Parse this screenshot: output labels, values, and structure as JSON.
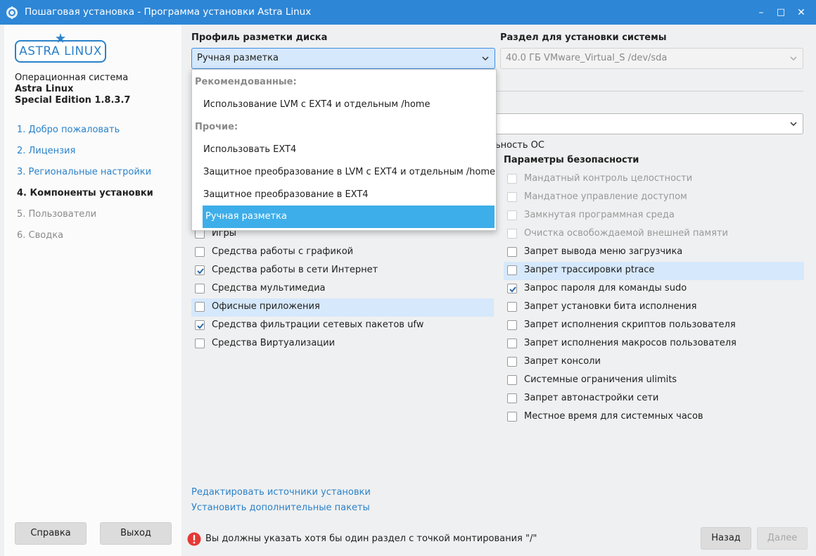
{
  "window": {
    "title": "Пошаговая установка - Программа установки Astra Linux",
    "controls": {
      "minimize": "–",
      "maximize": "□",
      "close": "✕"
    }
  },
  "sidebar": {
    "logo_text": "ASTRA LINUX",
    "os_line1": "Операционная система",
    "os_line2": "Astra Linux",
    "os_line3": "Special Edition 1.8.3.7",
    "steps": [
      {
        "label": "1. Добро пожаловать",
        "state": "link"
      },
      {
        "label": "2. Лицензия",
        "state": "link"
      },
      {
        "label": "3. Региональные настройки",
        "state": "link"
      },
      {
        "label": "4. Компоненты установки",
        "state": "active"
      },
      {
        "label": "5. Пользователи",
        "state": "disabled"
      },
      {
        "label": "6. Сводка",
        "state": "disabled"
      }
    ],
    "help_button": "Справка",
    "exit_button": "Выход"
  },
  "main": {
    "disk_profile_label": "Профиль разметки диска",
    "disk_profile_value": "Ручная разметка",
    "install_partition_label": "Раздел для установки системы",
    "install_partition_value": "40.0 ГБ VMware_Virtual_S /dev/sda",
    "partial_text": "ьность ОС",
    "components": [
      {
        "label": "Игры",
        "checked": false,
        "highlighted": false
      },
      {
        "label": "Средства работы с графикой",
        "checked": false,
        "highlighted": false
      },
      {
        "label": "Средства работы в сети Интернет",
        "checked": true,
        "highlighted": false
      },
      {
        "label": "Средства мультимедиа",
        "checked": false,
        "highlighted": false
      },
      {
        "label": "Офисные приложения",
        "checked": false,
        "highlighted": true
      },
      {
        "label": "Средства фильтрации сетевых пакетов ufw",
        "checked": true,
        "highlighted": false
      },
      {
        "label": "Средства Виртуализации",
        "checked": false,
        "highlighted": false
      }
    ],
    "security_title": "Параметры безопасности",
    "security": [
      {
        "label": "Мандатный контроль целостности",
        "checked": false,
        "disabled": true,
        "highlighted": false
      },
      {
        "label": "Мандатное управление доступом",
        "checked": false,
        "disabled": true,
        "highlighted": false
      },
      {
        "label": "Замкнутая программная среда",
        "checked": false,
        "disabled": true,
        "highlighted": false
      },
      {
        "label": "Очистка освобождаемой внешней памяти",
        "checked": false,
        "disabled": true,
        "highlighted": false
      },
      {
        "label": "Запрет вывода меню загрузчика",
        "checked": false,
        "disabled": false,
        "highlighted": false
      },
      {
        "label": "Запрет трассировки ptrace",
        "checked": false,
        "disabled": false,
        "highlighted": true
      },
      {
        "label": "Запрос пароля для команды sudo",
        "checked": true,
        "disabled": false,
        "highlighted": false
      },
      {
        "label": "Запрет установки бита исполнения",
        "checked": false,
        "disabled": false,
        "highlighted": false
      },
      {
        "label": "Запрет исполнения скриптов пользователя",
        "checked": false,
        "disabled": false,
        "highlighted": false
      },
      {
        "label": "Запрет исполнения макросов пользователя",
        "checked": false,
        "disabled": false,
        "highlighted": false
      },
      {
        "label": "Запрет консоли",
        "checked": false,
        "disabled": false,
        "highlighted": false
      },
      {
        "label": "Системные ограничения ulimits",
        "checked": false,
        "disabled": false,
        "highlighted": false
      },
      {
        "label": "Запрет автонастройки сети",
        "checked": false,
        "disabled": false,
        "highlighted": false
      },
      {
        "label": "Местное время для системных часов",
        "checked": false,
        "disabled": false,
        "highlighted": false
      }
    ],
    "link_edit_sources": "Редактировать источники установки",
    "link_install_packages": "Установить дополнительные пакеты",
    "error_message": "Вы должны указать хотя бы один раздел с точкой монтирования \"/\"",
    "back_button": "Назад",
    "next_button": "Далее"
  },
  "dropdown": {
    "group_recommended": "Рекомендованные:",
    "item_lvm_home": "Использование LVM с EXT4 и отдельным /home",
    "group_other": "Прочие:",
    "item_ext4": "Использовать EXT4",
    "item_enc_lvm": "Защитное преобразование в LVM с EXT4 и отдельным /home",
    "item_enc_ext4": "Защитное преобразование в EXT4",
    "item_manual": "Ручная разметка"
  },
  "colors": {
    "titlebar": "#2d86d6",
    "accent": "#3daee9",
    "link": "#2b82c9",
    "error": "#e53935",
    "highlight_row": "#d6e8fb"
  }
}
